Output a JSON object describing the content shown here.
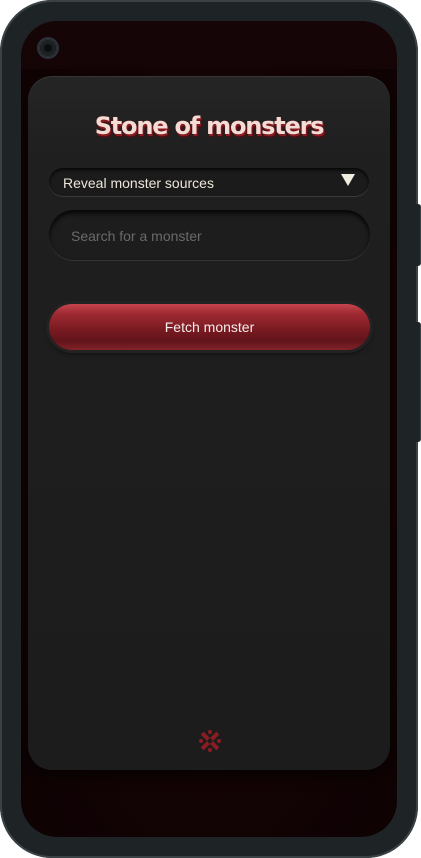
{
  "app": {
    "title": "Stone of monsters"
  },
  "sources_dropdown": {
    "label": "Reveal monster sources",
    "icon": "caret-down-icon"
  },
  "search": {
    "placeholder": "Search for a monster",
    "value": ""
  },
  "fetch_button": {
    "label": "Fetch monster"
  },
  "footer": {
    "logo_icon": "rune-logo-icon"
  },
  "colors": {
    "accent": "#8b1c22",
    "title_text": "#f4dcd6",
    "card_bg": "#1e1e1e",
    "screen_bg": "#120304"
  }
}
